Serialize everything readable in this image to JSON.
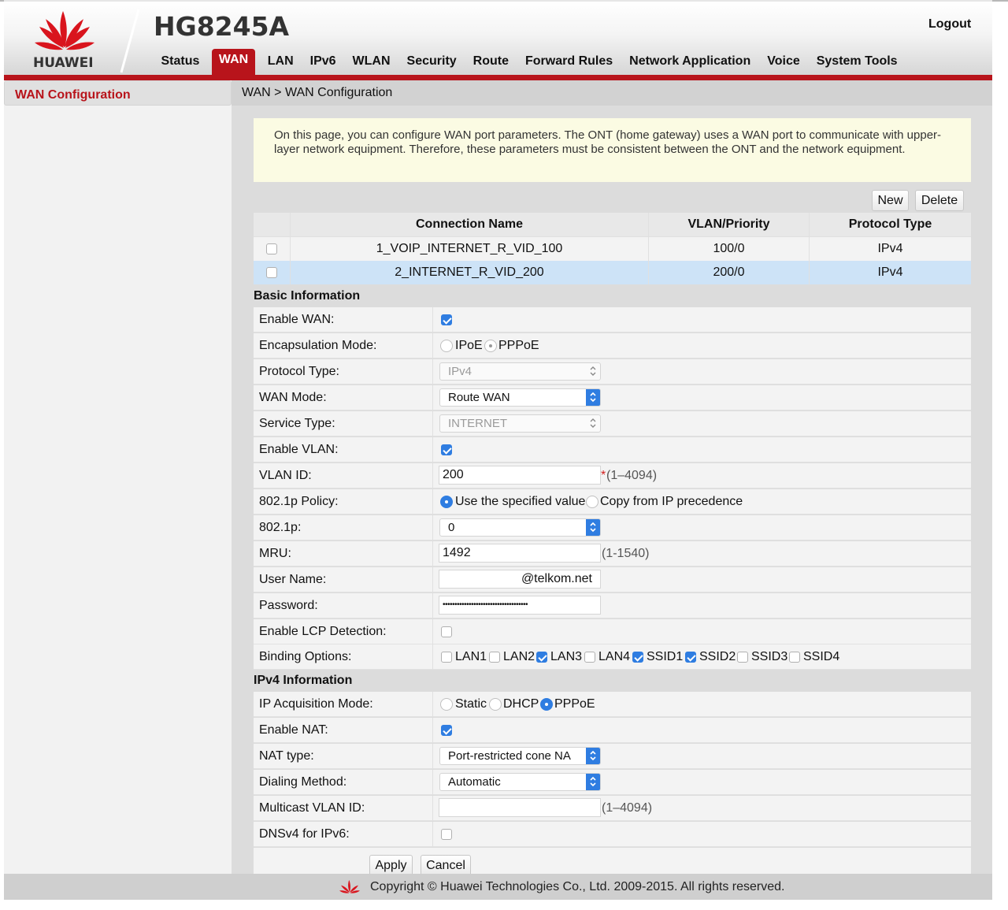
{
  "brand": {
    "logo_text": "HUAWEI",
    "model": "HG8245A",
    "logout": "Logout",
    "accent": "#b8141b"
  },
  "nav": {
    "items": [
      "Status",
      "WAN",
      "LAN",
      "IPv6",
      "WLAN",
      "Security",
      "Route",
      "Forward Rules",
      "Network Application",
      "Voice",
      "System Tools"
    ],
    "active": "WAN"
  },
  "sidebar": {
    "selected": "WAN Configuration"
  },
  "breadcrumb": "WAN > WAN Configuration",
  "notice": "On this page, you can configure WAN port parameters. The ONT (home gateway) uses a WAN port to communicate with upper-layer network equipment. Therefore, these parameters must be consistent between the ONT and the network equipment.",
  "actions": {
    "new": "New",
    "delete": "Delete"
  },
  "table": {
    "headers": {
      "name": "Connection Name",
      "vlan": "VLAN/Priority",
      "protocol": "Protocol Type"
    },
    "rows": [
      {
        "name": "1_VOIP_INTERNET_R_VID_100",
        "vlan": "100/0",
        "protocol": "IPv4"
      },
      {
        "name": "2_INTERNET_R_VID_200",
        "vlan": "200/0",
        "protocol": "IPv4"
      }
    ]
  },
  "basic": {
    "title": "Basic Information",
    "enable_wan": {
      "label": "Enable WAN:",
      "checked": true
    },
    "encap": {
      "label": "Encapsulation Mode:",
      "options": [
        "IPoE",
        "PPPoE"
      ],
      "selected": "PPPoE"
    },
    "protocol_type": {
      "label": "Protocol Type:",
      "value": "IPv4"
    },
    "wan_mode": {
      "label": "WAN Mode:",
      "value": "Route WAN"
    },
    "service_type": {
      "label": "Service Type:",
      "value": "INTERNET"
    },
    "enable_vlan": {
      "label": "Enable VLAN:",
      "checked": true
    },
    "vlan_id": {
      "label": "VLAN ID:",
      "value": "200",
      "required": "*",
      "hint": "(1–4094)"
    },
    "policy": {
      "label": "802.1p Policy:",
      "options": [
        "Use the specified value",
        "Copy from IP precedence"
      ],
      "selected": "Use the specified value"
    },
    "p8021": {
      "label": "802.1p:",
      "value": "0"
    },
    "mru": {
      "label": "MRU:",
      "value": "1492",
      "hint": "(1-1540)"
    },
    "username": {
      "label": "User Name:",
      "value": "@telkom.net"
    },
    "password": {
      "label": "Password:",
      "value": "••••••••••••••••••••••••••••••••••••"
    },
    "lcp": {
      "label": "Enable LCP Detection:",
      "checked": false
    },
    "binding": {
      "label": "Binding Options:",
      "options": [
        "LAN1",
        "LAN2",
        "LAN3",
        "LAN4",
        "SSID1",
        "SSID2",
        "SSID3",
        "SSID4"
      ],
      "checked": [
        "LAN3",
        "SSID1",
        "SSID2"
      ]
    }
  },
  "ipv4": {
    "title": "IPv4 Information",
    "acq": {
      "label": "IP Acquisition Mode:",
      "options": [
        "Static",
        "DHCP",
        "PPPoE"
      ],
      "selected": "PPPoE"
    },
    "nat": {
      "label": "Enable NAT:",
      "checked": true
    },
    "nat_type": {
      "label": "NAT type:",
      "value": "Port-restricted cone NA"
    },
    "dialing": {
      "label": "Dialing Method:",
      "value": "Automatic"
    },
    "mcast": {
      "label": "Multicast VLAN ID:",
      "value": "",
      "hint": "(1–4094)"
    },
    "dnsv4": {
      "label": "DNSv4 for IPv6:",
      "checked": false
    }
  },
  "buttons": {
    "apply": "Apply",
    "cancel": "Cancel"
  },
  "footer": "Copyright © Huawei Technologies Co., Ltd. 2009-2015. All rights reserved."
}
